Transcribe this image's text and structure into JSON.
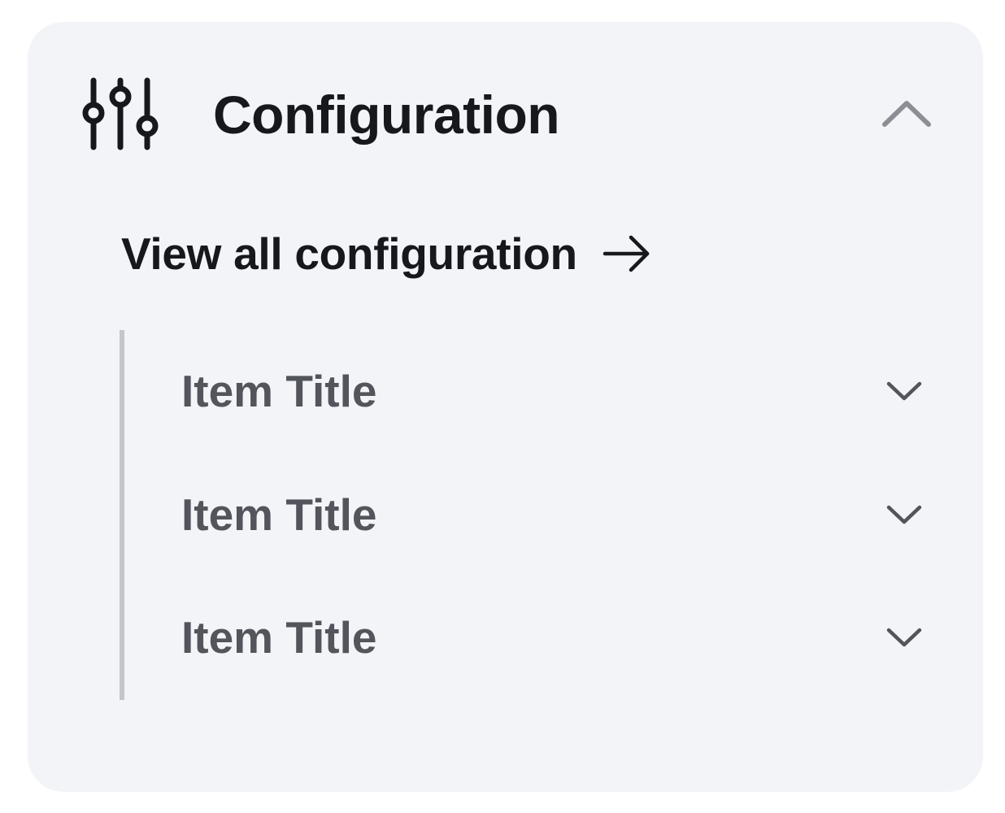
{
  "section": {
    "title": "Configuration",
    "icon": "sliders-icon",
    "expanded": true,
    "toggle_icon": "chevron-up-icon"
  },
  "view_all": {
    "label": "View all configuration",
    "icon": "arrow-right-icon"
  },
  "items": [
    {
      "label": "Item Title",
      "icon": "chevron-down-icon"
    },
    {
      "label": "Item Title",
      "icon": "chevron-down-icon"
    },
    {
      "label": "Item Title",
      "icon": "chevron-down-icon"
    }
  ],
  "colors": {
    "panel_background": "#f3f4f8",
    "title_text": "#16181d",
    "item_text": "#53555c",
    "rail": "#c5c6cb",
    "toggle_chevron": "#8c8e95"
  }
}
